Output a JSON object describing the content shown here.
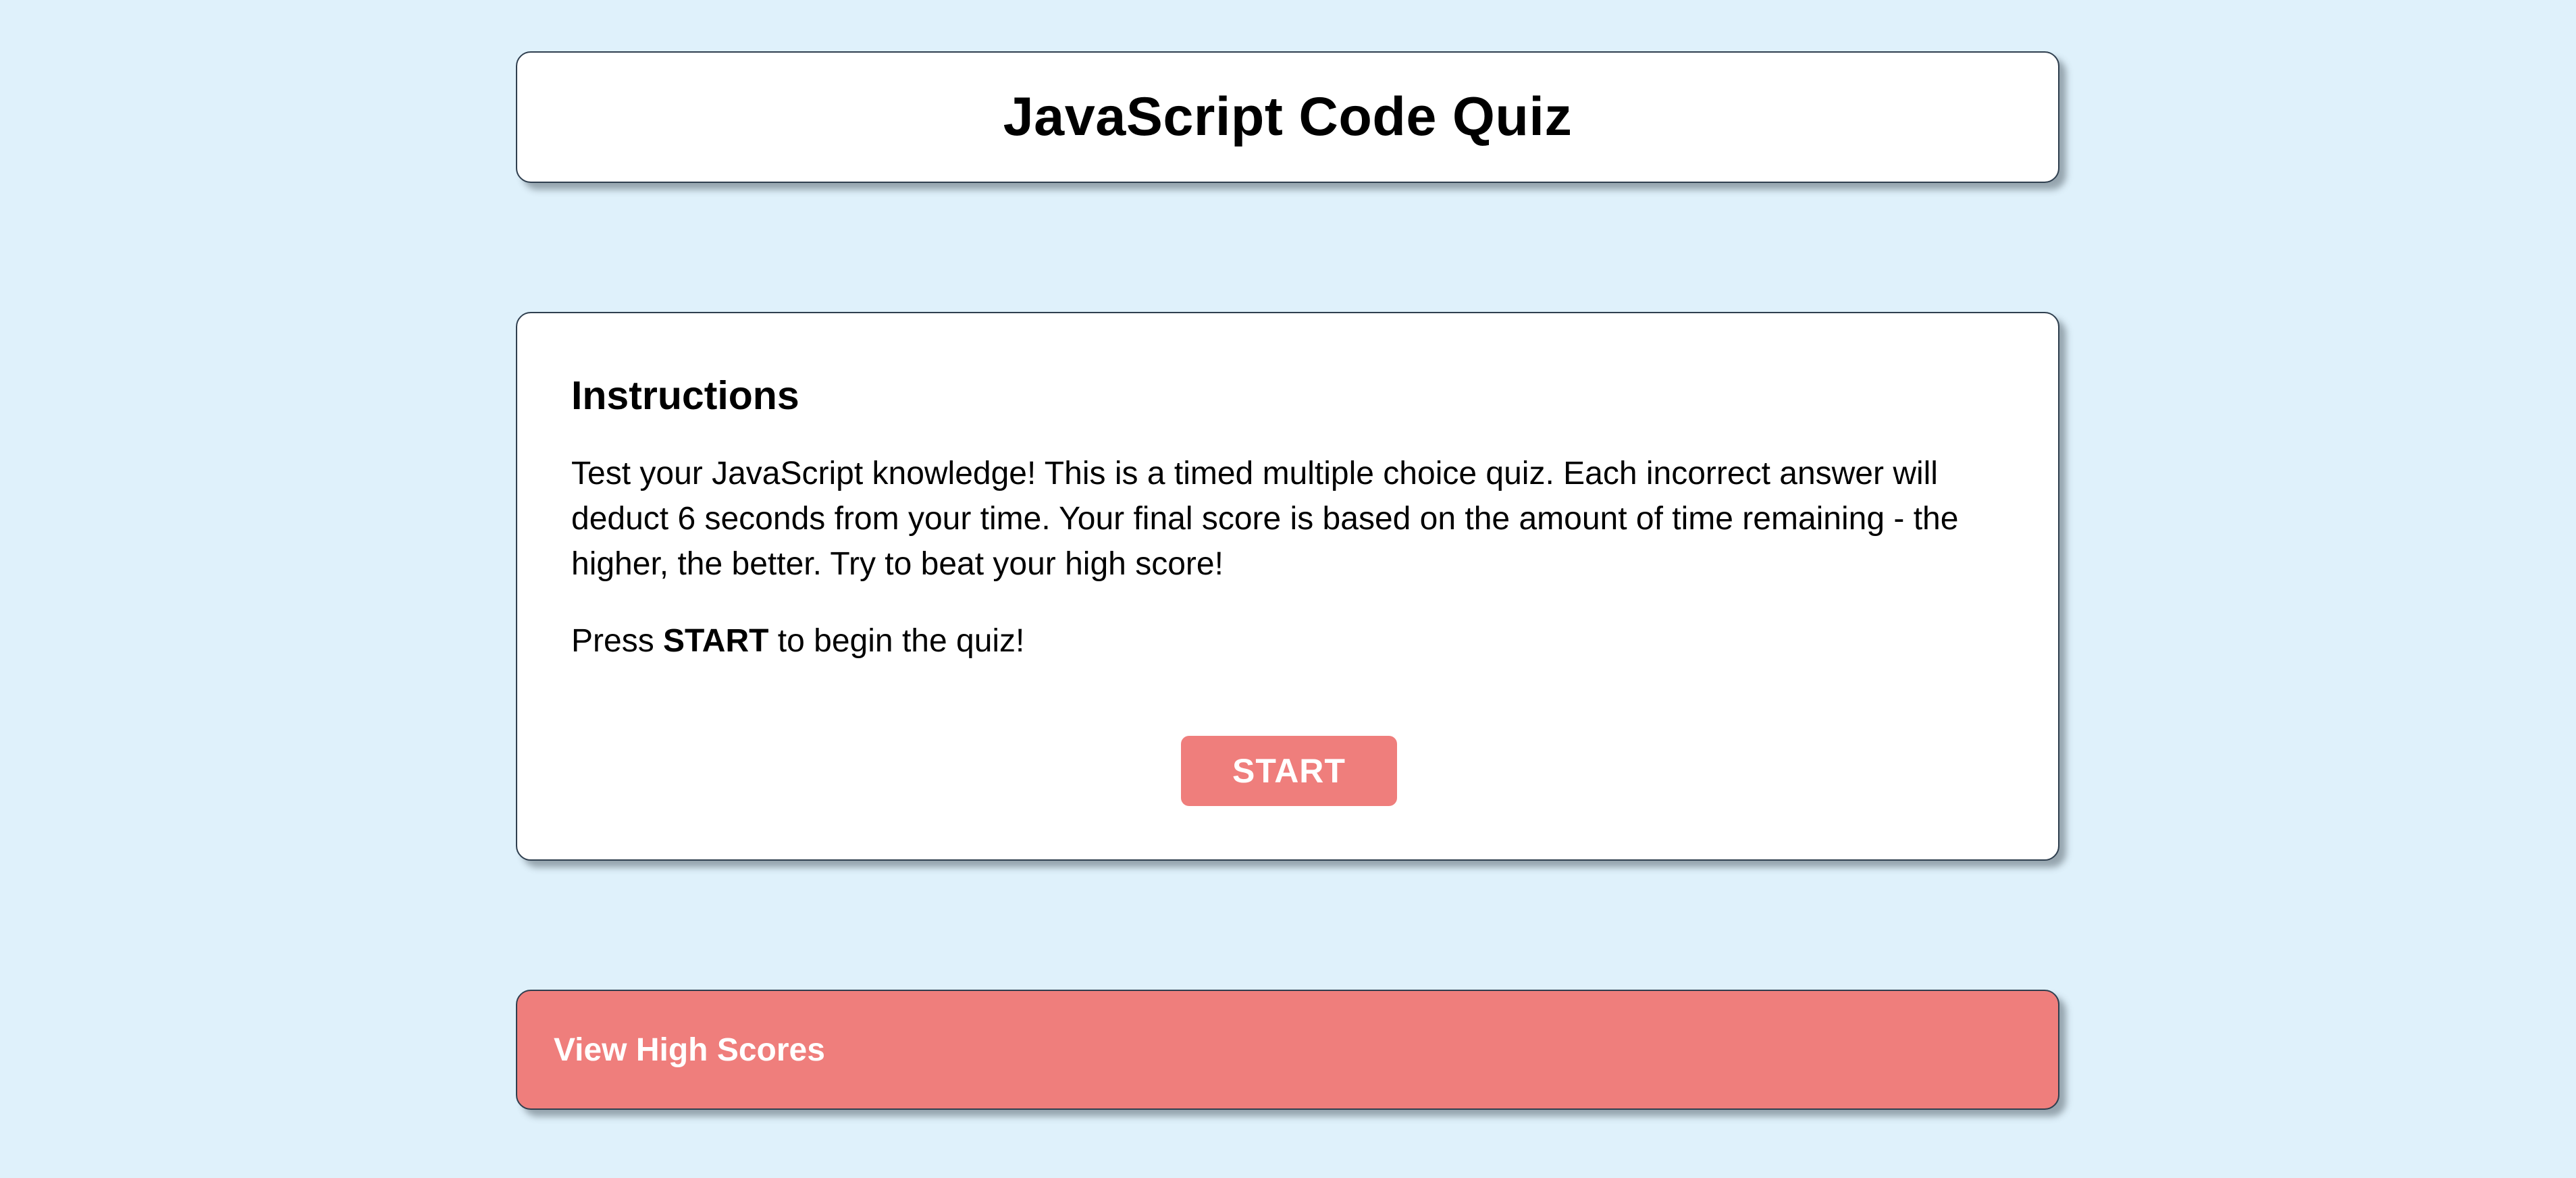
{
  "header": {
    "title": "JavaScript Code Quiz"
  },
  "instructions": {
    "heading": "Instructions",
    "body": "Test your JavaScript knowledge! This is a timed multiple choice quiz. Each incorrect answer will deduct 6 seconds from your time. Your final score is based on the amount of time remaining - the higher, the better. Try to beat your high score!",
    "press_prefix": "Press ",
    "press_strong": "START",
    "press_suffix": " to begin the quiz!",
    "start_label": "START"
  },
  "footer": {
    "high_scores_label": "View High Scores"
  },
  "colors": {
    "background": "#dff1fb",
    "accent": "#ef7e7c",
    "card": "#ffffff"
  }
}
